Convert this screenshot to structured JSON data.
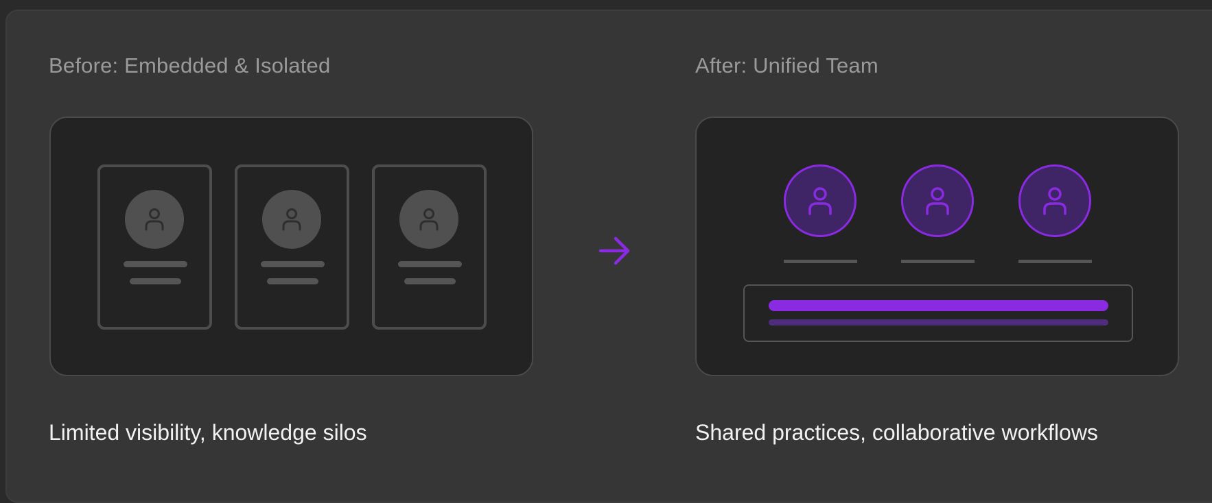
{
  "before": {
    "title": "Before: Embedded & Isolated",
    "caption": "Limited visibility, knowledge silos",
    "members": [
      {
        "icon": "user-icon"
      },
      {
        "icon": "user-icon"
      },
      {
        "icon": "user-icon"
      }
    ]
  },
  "after": {
    "title": "After: Unified Team",
    "caption": "Shared practices, collaborative workflows",
    "members": [
      {
        "icon": "user-icon"
      },
      {
        "icon": "user-icon"
      },
      {
        "icon": "user-icon"
      }
    ]
  },
  "transition_icon": "arrow-right-icon",
  "colors": {
    "background": "#363636",
    "panel": "#232323",
    "accent": "#8a2be2",
    "muted": "#555555",
    "title": "#9a9a9a",
    "caption": "#f2f2f2"
  }
}
